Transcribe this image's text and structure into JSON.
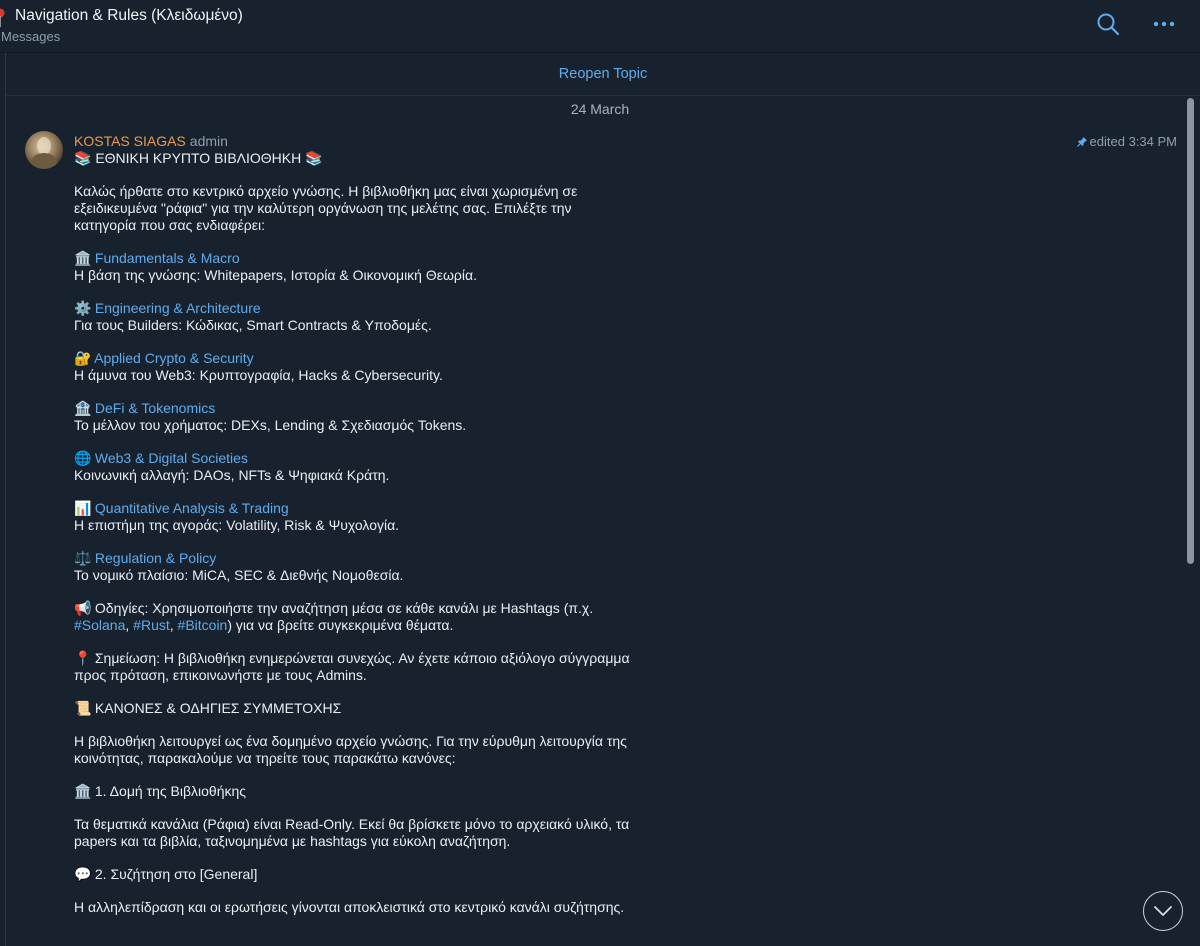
{
  "header": {
    "title": "Navigation & Rules (Κλειδωμένο)",
    "subtitle": "Messages",
    "search_icon": "search-icon",
    "more_icon": "more-dots-icon"
  },
  "reopen_label": "Reopen Topic",
  "date_separator": "24 March",
  "message": {
    "sender": "KOSTAS SIAGAS",
    "role": "admin",
    "edited_time": "edited 3:34 PM",
    "heading": "📚 ΕΘΝΙΚΗ ΚΡΥΠΤΟ ΒΙΒΛΙΟΘΗΚΗ 📚",
    "intro_1": "Καλώς ήρθατε στο κεντρικό αρχείο γνώσης. Η βιβλιοθήκη μας είναι χωρισμένη σε",
    "intro_2": "εξειδικευμένα \"ράφια\" για την καλύτερη οργάνωση της μελέτης σας. Επιλέξτε την",
    "intro_3": "κατηγορία που σας ενδιαφέρει:",
    "categories": [
      {
        "emoji": "🏛️",
        "title": "Fundamentals & Macro",
        "desc": "Η βάση της γνώσης: Whitepapers, Ιστορία & Οικονομική Θεωρία."
      },
      {
        "emoji": "⚙️",
        "title": "Engineering & Architecture",
        "desc": "Για τους Builders: Κώδικας, Smart Contracts & Υποδομές."
      },
      {
        "emoji": "🔐",
        "title": "Applied Crypto & Security",
        "desc": "Η άμυνα του Web3: Κρυπτογραφία, Hacks & Cybersecurity."
      },
      {
        "emoji": "🏦",
        "title": "DeFi & Tokenomics",
        "desc": "Το μέλλον του χρήματος: DEXs, Lending & Σχεδιασμός Tokens."
      },
      {
        "emoji": "🌐",
        "title": "Web3 & Digital Societies",
        "desc": "Κοινωνική αλλαγή: DAOs, NFTs & Ψηφιακά Κράτη."
      },
      {
        "emoji": "📊",
        "title": "Quantitative Analysis & Trading",
        "desc": "Η επιστήμη της αγοράς: Volatility, Risk & Ψυχολογία."
      },
      {
        "emoji": "⚖️",
        "title": "Regulation & Policy",
        "desc": "Το νομικό πλαίσιο: MiCA, SEC & Διεθνής Νομοθεσία."
      }
    ],
    "guide_emoji": "📢",
    "guide_text": "Οδηγίες: Χρησιμοποιήστε την αναζήτηση μέσα σε κάθε κανάλι με Hashtags (π.χ.",
    "tag_1": "#Solana",
    "tag_2": "#Rust",
    "tag_3": "#Bitcoin",
    "guide_sep": ", ",
    "guide_end": ") για να βρείτε συγκεκριμένα θέματα.",
    "note_emoji": "📍",
    "note_1": "Σημείωση: Η βιβλιοθήκη ενημερώνεται συνεχώς. Αν έχετε κάποιο αξιόλογο σύγγραμμα",
    "note_2": "προς πρόταση, επικοινωνήστε με τους Admins.",
    "rules_emoji": "📜",
    "rules_title": "ΚΑΝΟΝΕΣ & ΟΔΗΓΙΕΣ ΣΥΜΜΕΤΟΧΗΣ",
    "rules_intro_1": "Η βιβλιοθήκη λειτουργεί ως ένα δομημένο αρχείο γνώσης. Για την εύρυθμη λειτουργία της",
    "rules_intro_2": "κοινότητας, παρακαλούμε να τηρείτε τους παρακάτω κανόνες:",
    "rule1_emoji": "🏛️",
    "rule1_title": "1. Δομή της Βιβλιοθήκης",
    "rule1_text_1": "Τα θεματικά κανάλια (Ράφια) είναι Read-Only. Εκεί θα βρίσκετε μόνο το αρχειακό υλικό, τα",
    "rule1_text_2": "papers και τα βιβλία, ταξινομημένα με hashtags για εύκολη αναζήτηση.",
    "rule2_emoji": "💬",
    "rule2_title": "2. Συζήτηση στο [General]",
    "rule2_text": "Η αλληλεπίδραση και οι ερωτήσεις γίνονται αποκλειστικά στο κεντρικό κανάλι συζήτησης."
  },
  "colors": {
    "background": "#18222f",
    "link": "#5eacec",
    "sender": "#e99a4a",
    "muted": "#8f9dad"
  }
}
